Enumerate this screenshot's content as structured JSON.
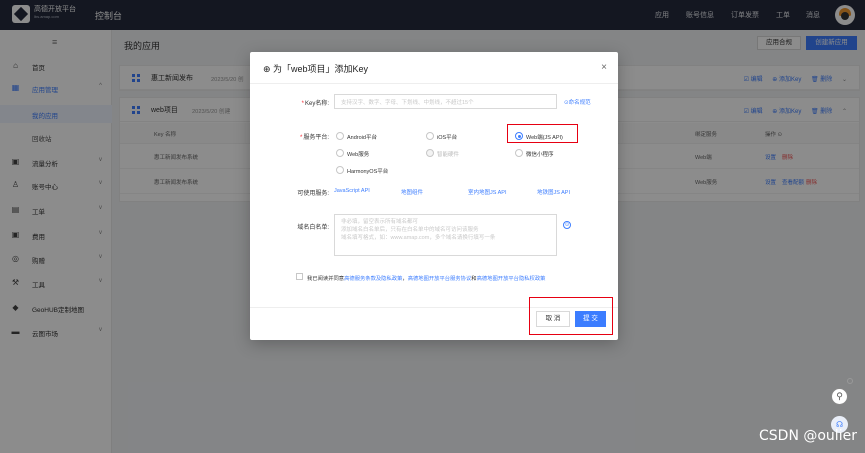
{
  "topbar": {
    "logo_text": "高德开放平台",
    "logo_sub": "lbs.amap.com",
    "console": "控制台",
    "nav": [
      "应用",
      "账号信息",
      "订单发票",
      "工单",
      "消息"
    ]
  },
  "sidebar": {
    "collapse_icon": "≡",
    "items": [
      {
        "label": "首页",
        "icon": "home-icon",
        "glyph": "⌂"
      },
      {
        "label": "应用管理",
        "icon": "app-grid-icon",
        "glyph": "▦",
        "arrow": "^"
      },
      {
        "label": "我的应用",
        "sub": true,
        "active": true
      },
      {
        "label": "回收站",
        "sub": true
      },
      {
        "label": "流量分析",
        "icon": "chart-icon",
        "glyph": "▣",
        "arrow": "v"
      },
      {
        "label": "账号中心",
        "icon": "account-icon",
        "glyph": "♙",
        "arrow": "v"
      },
      {
        "label": "工单",
        "icon": "ticket-icon",
        "glyph": "▤",
        "arrow": "v"
      },
      {
        "label": "费用",
        "icon": "fee-icon",
        "glyph": "▣",
        "arrow": "v"
      },
      {
        "label": "购赠",
        "icon": "gift-icon",
        "glyph": "◎",
        "arrow": "v"
      },
      {
        "label": "工具",
        "icon": "tool-icon",
        "glyph": "⚒",
        "arrow": "v"
      },
      {
        "label": "GeoHUB定制地图",
        "icon": "map-icon",
        "glyph": "◆"
      },
      {
        "label": "云图市场",
        "icon": "market-icon",
        "glyph": "▬",
        "arrow": "v"
      }
    ]
  },
  "main": {
    "title": "我的应用",
    "buttons": {
      "app_check": "应用合规",
      "create_app": "创建新应用"
    },
    "card1": {
      "name": "惠工新闻发布",
      "date": "2023/5/20 创",
      "actions": [
        "☑ 编辑",
        "⊕ 添加Key",
        "🗑 删除",
        "⌄"
      ]
    },
    "card2": {
      "name": "web项目",
      "date": "2023/5/20 创建",
      "actions": [
        "☑ 编辑",
        "⊕ 添加Key",
        "🗑 删除",
        "⌃"
      ]
    },
    "table": {
      "headers": {
        "key_name": "Key 名称",
        "bound_service": "绑定服务",
        "ops": "操作 ⊙"
      },
      "rows": [
        {
          "name": "惠工新闻发布系统",
          "service": "Web端",
          "ops": [
            "设置",
            "删除"
          ]
        },
        {
          "name": "惠工新闻发布系统",
          "service": "Web服务",
          "ops": [
            "设置",
            "查看配额",
            "删除"
          ]
        }
      ]
    }
  },
  "modal": {
    "title": "⊕ 为「web项目」添加Key",
    "close": "×",
    "key_name_label": "Key名称:",
    "key_name_placeholder": "支持汉字、数字、字母、下划线、中划线，不超过15个",
    "naming_rule": "⊙命名规范",
    "service_label": "服务平台:",
    "platforms": [
      {
        "label": "Android平台",
        "checked": false,
        "disabled": false
      },
      {
        "label": "iOS平台",
        "checked": false,
        "disabled": false
      },
      {
        "label": "Web端(JS API)",
        "checked": true,
        "disabled": false
      },
      {
        "label": "Web服务",
        "checked": false,
        "disabled": false
      },
      {
        "label": "智能硬件",
        "checked": false,
        "disabled": true
      },
      {
        "label": "微信小程序",
        "checked": false,
        "disabled": false
      },
      {
        "label": "HarmonyOS平台",
        "checked": false,
        "disabled": false
      }
    ],
    "available_label": "可使用服务:",
    "available_services": [
      "JavaScript API",
      "地图组件",
      "室内地图JS API",
      "地铁图JS API"
    ],
    "domain_label": "域名白名单:",
    "domain_placeholder": [
      "非必填，留空表示所有域名都可",
      "添加域名白名单后，只有在白名单中的域名可访问该服务",
      "域名填写格式，如：www.amap.com，多个域名请换行填写一条"
    ],
    "domain_help_icon": "⊙",
    "agree_prefix": "我已阅读并同意",
    "agree_links": [
      "高德服务条款及隐私政策",
      "高德地图开放平台服务协议",
      "高德地图开放平台隐私权政策"
    ],
    "agree_sep1": "，",
    "agree_sep2": "和",
    "cancel": "取 消",
    "submit": "提 交"
  },
  "floating": {
    "help": "⚲",
    "feedback": "☊"
  },
  "watermark": "CSDN @oulier",
  "colors": {
    "primary": "#3c7dff",
    "topbar": "#252b3d",
    "highlight": "#e60012",
    "danger": "#f05050"
  }
}
